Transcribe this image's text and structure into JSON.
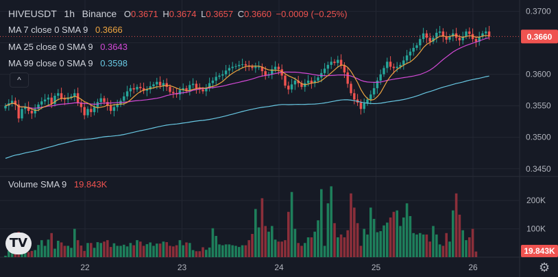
{
  "header": {
    "symbol": "HIVEUSDT",
    "interval": "1h",
    "exchange": "Binance",
    "open_label": "O",
    "open": "0.3671",
    "high_label": "H",
    "high": "0.3674",
    "low_label": "L",
    "low": "0.3657",
    "close_label": "C",
    "close": "0.3660",
    "change": "−0.0009 (−0.25%)"
  },
  "indicators": [
    {
      "label": "MA 7 close 0 SMA 9",
      "value": "0.3666",
      "color": "#f0a641"
    },
    {
      "label": "MA 25 close 0 SMA 9",
      "value": "0.3643",
      "color": "#d54ad8"
    },
    {
      "label": "MA 99 close 0 SMA 9",
      "value": "0.3598",
      "color": "#69c9e4"
    }
  ],
  "volume_legend": {
    "label": "Volume SMA 9",
    "value": "19.843K"
  },
  "collapse_icon": "chevron-up-icon",
  "logo_text": "TV",
  "settings_icon": "gear-icon",
  "colors": {
    "up": "#26a69a",
    "down": "#ef5350",
    "vol_up": "#1e7f5b",
    "vol_down": "#8b2f3a",
    "bg": "#161a25",
    "grid": "#232733"
  },
  "chart_data": {
    "type": "candlestick",
    "price_axis": {
      "ticks": [
        "0.3700",
        "0.3650",
        "0.3600",
        "0.3550",
        "0.3500",
        "0.3450"
      ],
      "ylim": [
        0.344,
        0.3718
      ]
    },
    "current_price_label": "0.3660",
    "volume_axis": {
      "ticks": [
        "200K",
        "100K"
      ],
      "ylim": [
        0,
        280000
      ]
    },
    "current_volume_label": "19.843K",
    "x_ticks": [
      "22",
      "23",
      "24",
      "25",
      "26"
    ],
    "closes": [
      0.355,
      0.3554,
      0.3558,
      0.3552,
      0.353,
      0.3545,
      0.3548,
      0.3542,
      0.3538,
      0.3545,
      0.3552,
      0.3557,
      0.356,
      0.3563,
      0.3553,
      0.3566,
      0.357,
      0.3562,
      0.356,
      0.3563,
      0.3565,
      0.357,
      0.3555,
      0.3548,
      0.3535,
      0.3545,
      0.354,
      0.3548,
      0.3556,
      0.3562,
      0.3556,
      0.355,
      0.3542,
      0.3548,
      0.3552,
      0.3558,
      0.3565,
      0.3573,
      0.3578,
      0.3576,
      0.358,
      0.3578,
      0.3574,
      0.3576,
      0.3581,
      0.3584,
      0.3588,
      0.3582,
      0.3586,
      0.358,
      0.3572,
      0.357,
      0.3568,
      0.3575,
      0.3578,
      0.3574,
      0.3583,
      0.3585,
      0.3578,
      0.3576,
      0.3573,
      0.3578,
      0.3586,
      0.359,
      0.3596,
      0.3598,
      0.36,
      0.3606,
      0.361,
      0.3612,
      0.3613,
      0.3615,
      0.3616,
      0.3614,
      0.3612,
      0.361,
      0.3612,
      0.3612,
      0.3605,
      0.3598,
      0.36,
      0.3608,
      0.3612,
      0.3608,
      0.3598,
      0.3582,
      0.3576,
      0.3584,
      0.359,
      0.3586,
      0.358,
      0.3586,
      0.359,
      0.3586,
      0.359,
      0.3595,
      0.3602,
      0.3609,
      0.3615,
      0.362,
      0.3618,
      0.3623,
      0.3614,
      0.3603,
      0.3585,
      0.357,
      0.356,
      0.3555,
      0.3545,
      0.3554,
      0.356,
      0.3568,
      0.3578,
      0.359,
      0.36,
      0.361,
      0.362,
      0.3612,
      0.361,
      0.3612,
      0.3615,
      0.3622,
      0.363,
      0.3636,
      0.3642,
      0.3646,
      0.3656,
      0.3665,
      0.3658,
      0.3652,
      0.3658,
      0.3666,
      0.3668,
      0.366,
      0.3655,
      0.366,
      0.3665,
      0.3658,
      0.3654,
      0.366,
      0.3668,
      0.3664,
      0.3656,
      0.3652,
      0.366,
      0.3665,
      0.3668,
      0.366
    ],
    "volumes": [
      5000,
      22000,
      70000,
      65000,
      90000,
      55000,
      48000,
      18000,
      22000,
      25000,
      43000,
      60000,
      40000,
      62000,
      85000,
      30000,
      58000,
      52000,
      40000,
      40000,
      33000,
      100000,
      60000,
      41000,
      22000,
      50000,
      50000,
      33000,
      53000,
      50000,
      55000,
      60000,
      36000,
      49000,
      40000,
      40000,
      44000,
      38000,
      50000,
      42000,
      60000,
      55000,
      40000,
      46000,
      52000,
      40000,
      48000,
      48000,
      55000,
      53000,
      40000,
      38000,
      42000,
      60000,
      42000,
      52000,
      50000,
      25000,
      21000,
      21000,
      35000,
      26000,
      34000,
      102000,
      75000,
      45000,
      42000,
      45000,
      45000,
      42000,
      40000,
      36000,
      42000,
      42000,
      60000,
      82000,
      170000,
      105000,
      208000,
      110000,
      90000,
      110000,
      62000,
      55000,
      55000,
      60000,
      160000,
      230000,
      100000,
      50000,
      40000,
      50000,
      70000,
      70000,
      90000,
      130000,
      240000,
      40000,
      190000,
      250000,
      120000,
      70000,
      80000,
      70000,
      95000,
      225000,
      175000,
      120000,
      40000,
      100000,
      80000,
      175000,
      135000,
      88000,
      92000,
      112000,
      122000,
      140000,
      160000,
      165000,
      110000,
      140000,
      190000,
      145000,
      85000,
      80000,
      85000,
      80000,
      80000,
      55000,
      110000,
      80000,
      45000,
      40000,
      85000,
      55000,
      165000,
      225000,
      150000,
      95000,
      60000,
      70000,
      100000,
      20000
    ]
  }
}
